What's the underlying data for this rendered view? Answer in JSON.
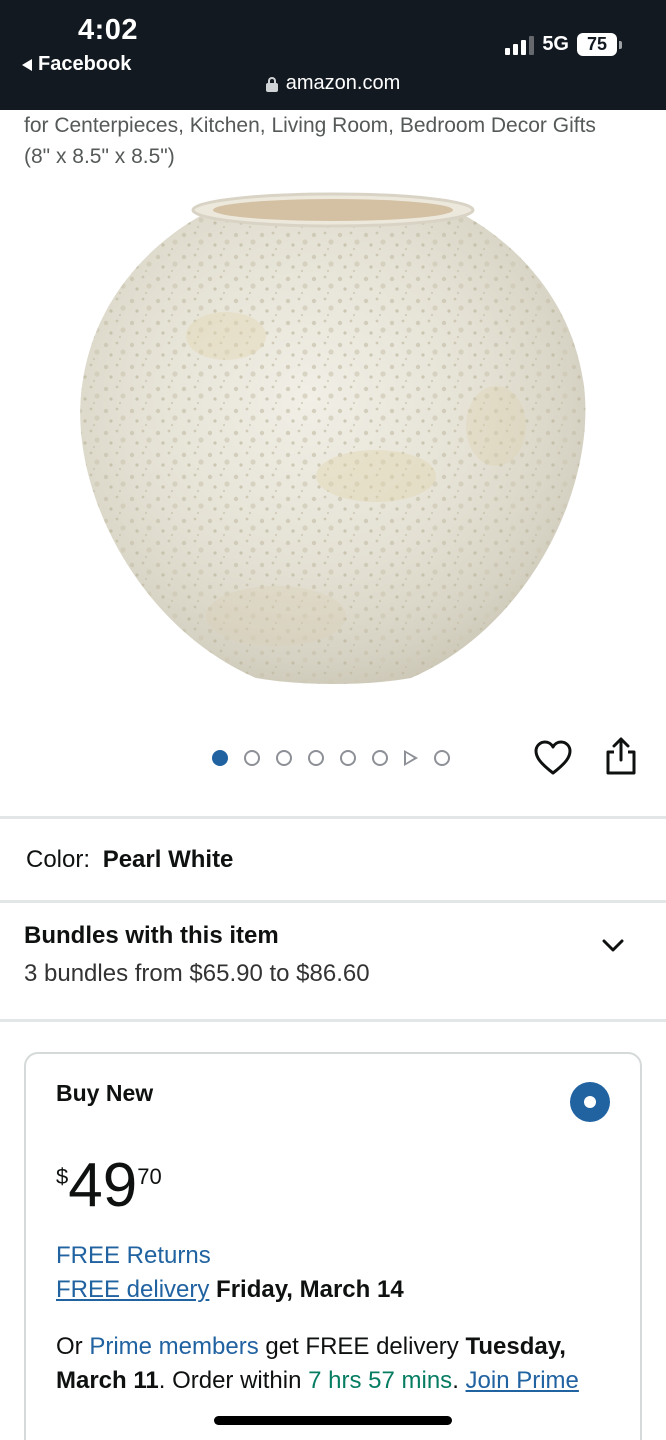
{
  "status_bar": {
    "time": "4:02",
    "back_app": "Facebook",
    "network": "5G",
    "battery": "75",
    "url": "amazon.com"
  },
  "product": {
    "title_line1": "for Centerpieces, Kitchen, Living Room, Bedroom Decor Gifts",
    "title_line2": "(8\" x 8.5\" x 8.5\")",
    "gallery": {
      "active_index": 0,
      "total_images": 7,
      "has_video": true
    }
  },
  "color": {
    "label": "Color:",
    "value": "Pearl White"
  },
  "bundles": {
    "title": "Bundles with this item",
    "subtitle": "3 bundles from $65.90 to $86.60"
  },
  "buy_new": {
    "title": "Buy New",
    "price_symbol": "$",
    "price_whole": "49",
    "price_fraction": "70",
    "returns": "FREE Returns",
    "delivery_link": "FREE delivery",
    "delivery_date": "Friday, March 14",
    "prime_or": "Or",
    "prime_link": "Prime members",
    "prime_get": "get FREE delivery",
    "prime_date": "Tuesday, March 11",
    "order_within": ". Order within",
    "countdown": "7 hrs 57 mins",
    "period": ".",
    "join_prime": "Join Prime"
  },
  "icons": {
    "back": "back-triangle-icon",
    "lock": "lock-icon",
    "heart": "heart-icon",
    "share": "share-icon",
    "chevron": "chevron-down-icon",
    "play": "play-icon"
  },
  "colors": {
    "header_bg": "#131921",
    "link": "#2162a1",
    "success": "#067d62",
    "border": "#d5d9d9"
  }
}
